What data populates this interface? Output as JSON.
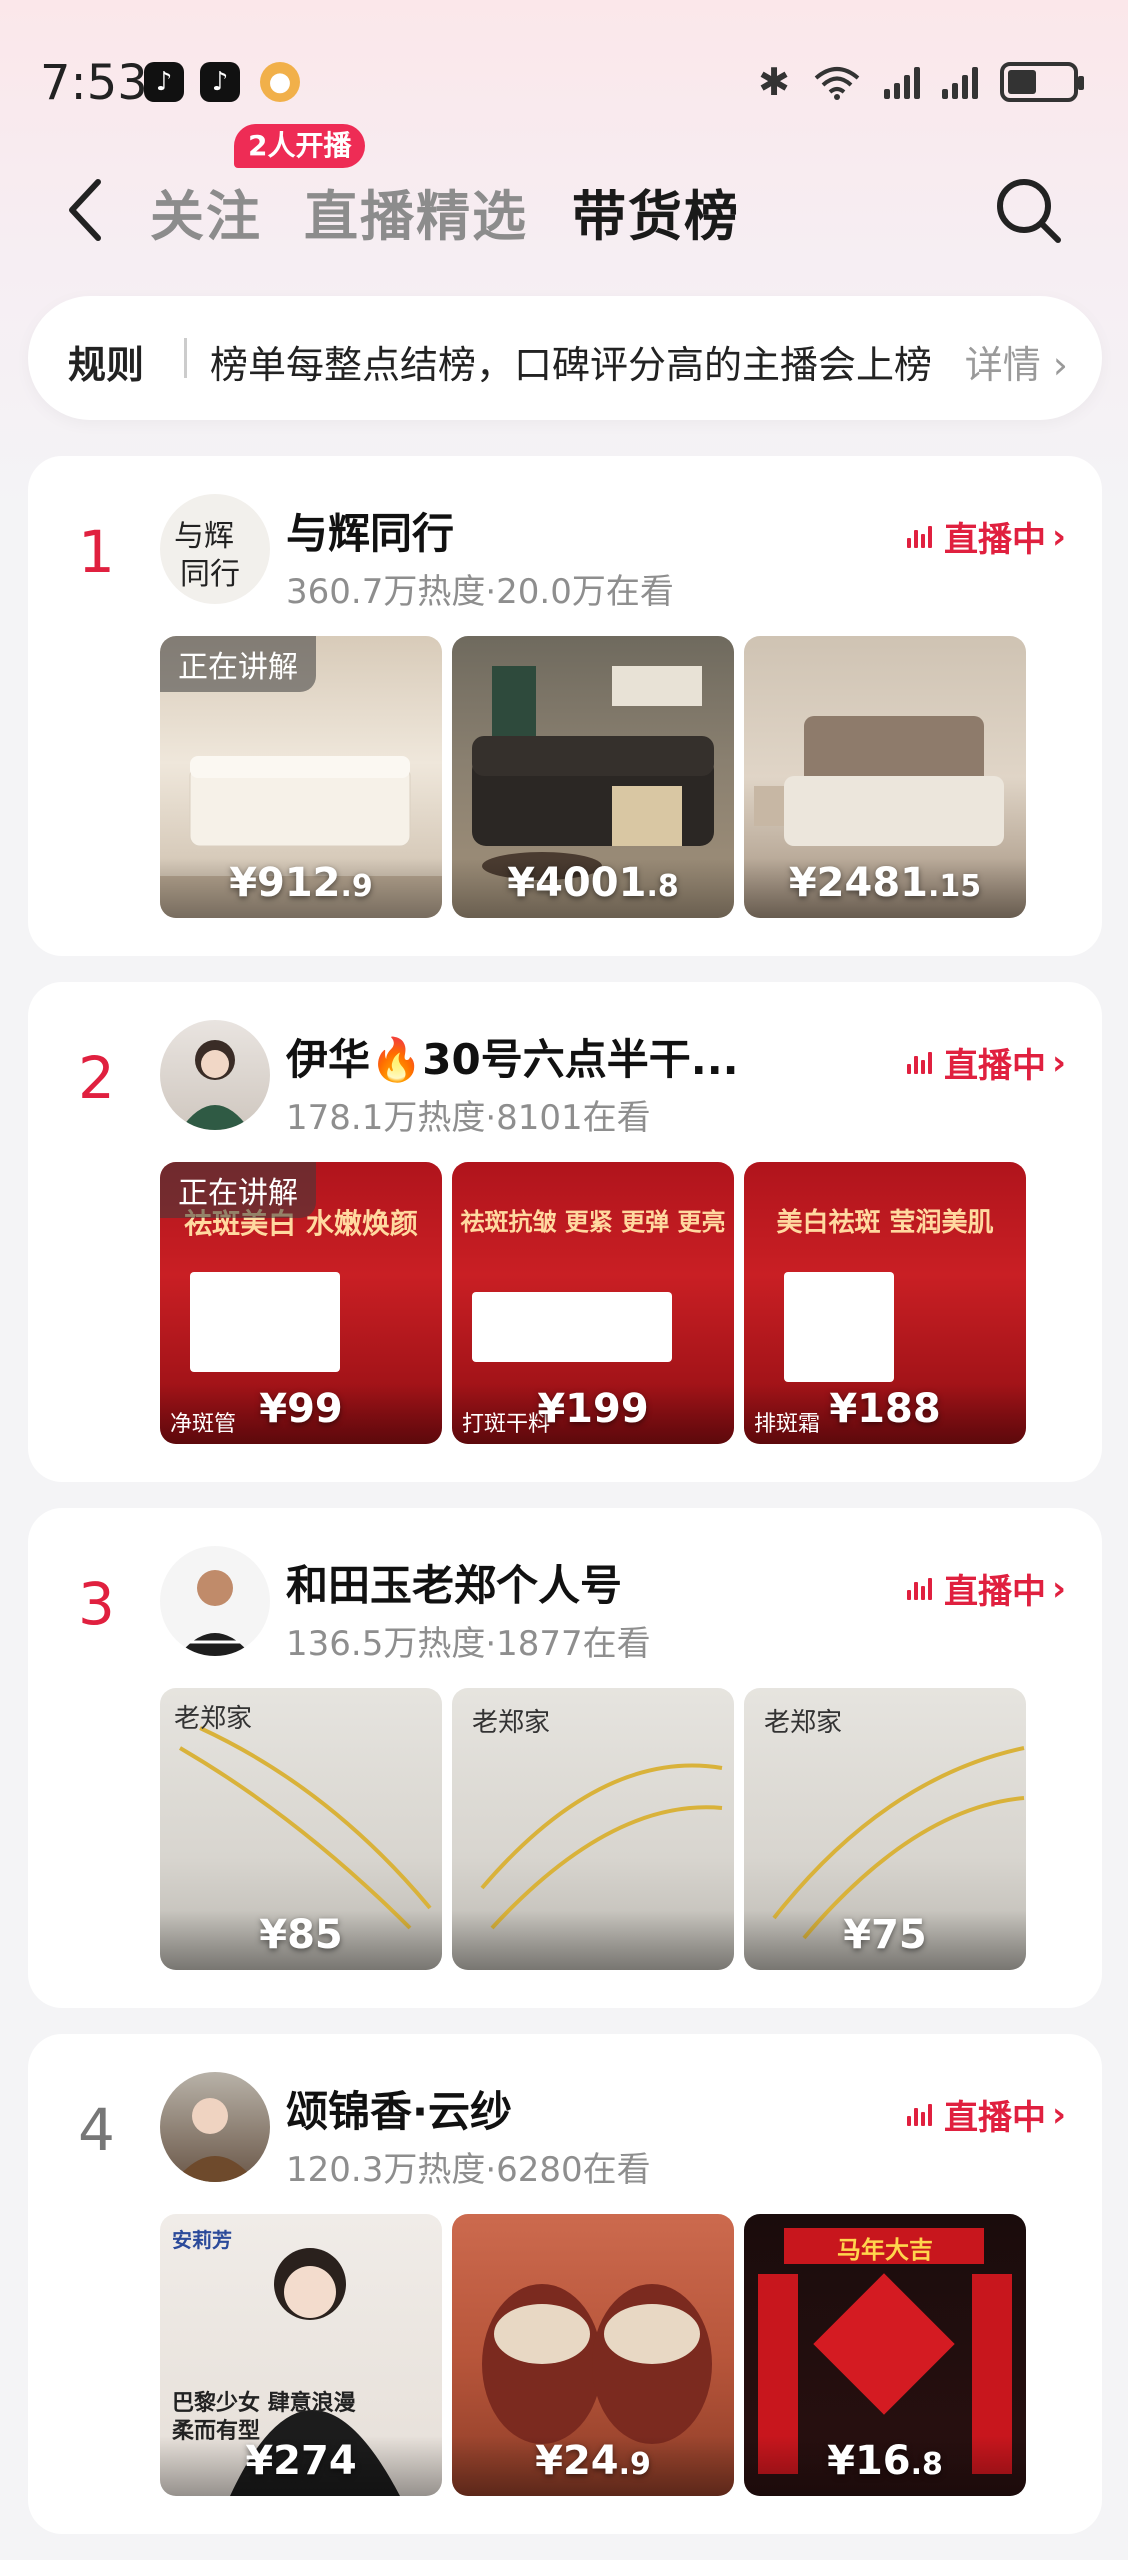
{
  "status_bar": {
    "time": "7:53",
    "app_icons": [
      "tiktok-icon",
      "tiktok-icon",
      "coin-icon"
    ]
  },
  "header": {
    "tabs": [
      {
        "label": "关注",
        "active": false
      },
      {
        "label": "直播精选",
        "active": false
      },
      {
        "label": "带货榜",
        "active": true
      }
    ],
    "live_badge": "2人开播"
  },
  "rules": {
    "title": "规则",
    "text": "榜单每整点结榜，口碑评分高的主播会上榜",
    "detail": "详情"
  },
  "colors": {
    "accent_red": "#e0203f",
    "badge_pink": "#ee2c55"
  },
  "cards": [
    {
      "rank": "1",
      "name": "与辉同行",
      "stats": "360.7万热度·20.0万在看",
      "live_label": "直播中",
      "avatar_text": "与辉同行",
      "products": [
        {
          "tag": "正在讲解",
          "price_main": "¥912",
          "price_dec": ".9"
        },
        {
          "tag": "",
          "price_main": "¥4001",
          "price_dec": ".8"
        },
        {
          "tag": "",
          "price_main": "¥2481",
          "price_dec": ".15"
        }
      ]
    },
    {
      "rank": "2",
      "name": "伊华🔥30号六点半干...",
      "stats": "178.1万热度·8101在看",
      "live_label": "直播中",
      "products": [
        {
          "tag": "正在讲解",
          "price_main": "¥99",
          "price_dec": "",
          "overlay": "祛斑美白 水嫩焕颜",
          "bottom": "净斑管"
        },
        {
          "tag": "",
          "price_main": "¥199",
          "price_dec": "",
          "overlay": "祛斑抗皱 更紧 更弹 更亮",
          "bottom": "打斑干料"
        },
        {
          "tag": "",
          "price_main": "¥188",
          "price_dec": "",
          "overlay": "美白祛斑 莹润美肌",
          "bottom": "排斑霜"
        }
      ]
    },
    {
      "rank": "3",
      "name": "和田玉老郑个人号",
      "stats": "136.5万热度·1877在看",
      "live_label": "直播中",
      "products": [
        {
          "tag": "",
          "price_main": "¥85",
          "price_dec": "",
          "brand": "老郑家"
        },
        {
          "tag": "",
          "price_main": "",
          "price_dec": "",
          "brand": "老郑家"
        },
        {
          "tag": "",
          "price_main": "¥75",
          "price_dec": "",
          "brand": "老郑家"
        }
      ]
    },
    {
      "rank": "4",
      "name": "颂锦香·云纱",
      "stats": "120.3万热度·6280在看",
      "live_label": "直播中",
      "products": [
        {
          "tag": "",
          "price_main": "¥274",
          "price_dec": "",
          "overlay": "巴黎少女 肆意浪漫 柔而有型",
          "brand": "安莉芳"
        },
        {
          "tag": "",
          "price_main": "¥24",
          "price_dec": ".9"
        },
        {
          "tag": "",
          "price_main": "¥16",
          "price_dec": ".8",
          "overlay": "马年大吉"
        }
      ]
    }
  ]
}
